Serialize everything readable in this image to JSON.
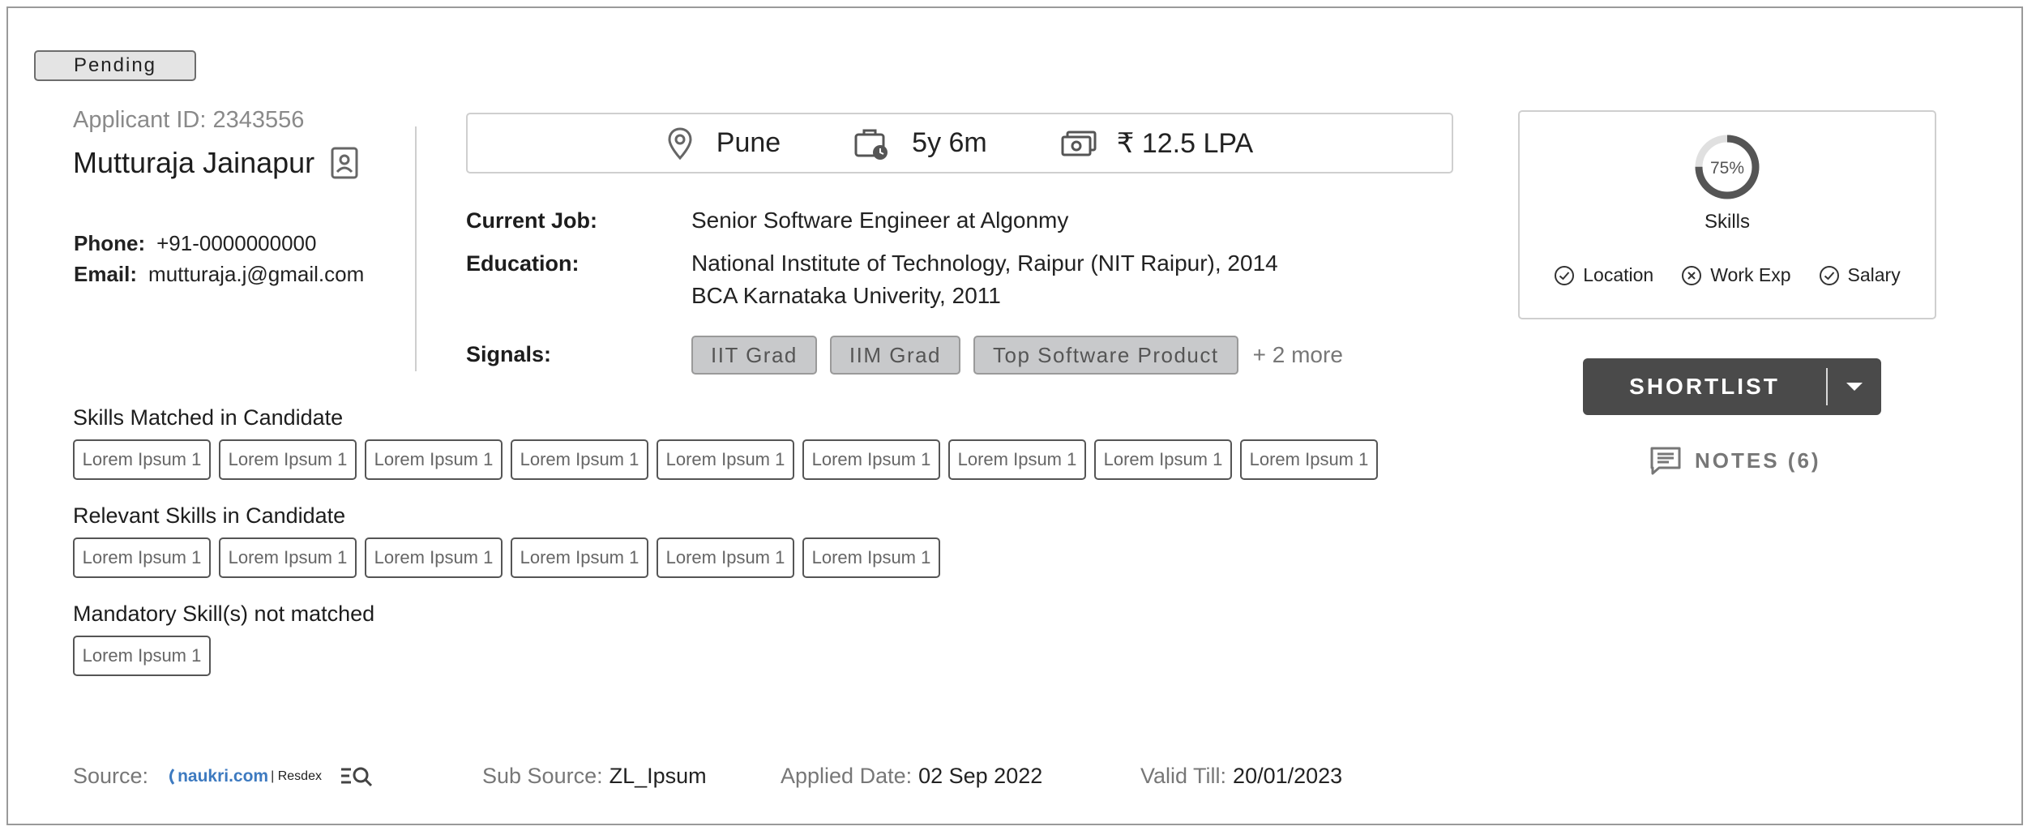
{
  "status": "Pending",
  "applicant": {
    "id_label": "Applicant ID: 2343556",
    "name": "Mutturaja Jainapur",
    "phone_label": "Phone:",
    "phone": "+91-0000000000",
    "email_label": "Email:",
    "email": "mutturaja.j@gmail.com"
  },
  "info_bar": {
    "location": "Pune",
    "experience": "5y 6m",
    "salary": "₹ 12.5 LPA"
  },
  "details": {
    "current_job_label": "Current Job:",
    "current_job": "Senior Software Engineer at Algonmy",
    "education_label": "Education:",
    "education": [
      "National Institute of Technology, Raipur (NIT Raipur), 2014",
      "BCA Karnataka Univerity, 2011"
    ],
    "signals_label": "Signals:",
    "signals": [
      "IIT Grad",
      "IIM Grad",
      "Top Software Product"
    ],
    "signals_more": "+ 2 more"
  },
  "skills_matched": {
    "title": "Skills Matched in Candidate",
    "items": [
      "Lorem Ipsum 1",
      "Lorem Ipsum 1",
      "Lorem Ipsum 1",
      "Lorem Ipsum 1",
      "Lorem Ipsum 1",
      "Lorem Ipsum 1",
      "Lorem Ipsum 1",
      "Lorem Ipsum 1",
      "Lorem Ipsum 1"
    ]
  },
  "relevant_skills": {
    "title": "Relevant Skills in Candidate",
    "items": [
      "Lorem Ipsum 1",
      "Lorem Ipsum 1",
      "Lorem Ipsum 1",
      "Lorem Ipsum 1",
      "Lorem Ipsum 1",
      "Lorem Ipsum 1"
    ]
  },
  "mandatory_unmatched": {
    "title": "Mandatory Skill(s) not matched",
    "items": [
      "Lorem Ipsum 1"
    ]
  },
  "match": {
    "percent": 75,
    "percent_label": "75%",
    "label": "Skills",
    "criteria": [
      {
        "label": "Location",
        "state": "matched",
        "icon": "check-circle-icon"
      },
      {
        "label": "Work Exp",
        "state": "unmatched",
        "icon": "x-circle-icon"
      },
      {
        "label": "Salary",
        "state": "matched",
        "icon": "check-circle-icon"
      }
    ]
  },
  "actions": {
    "shortlist_label": "SHORTLIST",
    "notes_label": "NOTES (6)"
  },
  "footer": {
    "source_label": "Source:",
    "source_brand": "naukri.com",
    "source_brand_suffix": "| Resdex",
    "sub_source_label": "Sub Source:",
    "sub_source": "ZL_Ipsum",
    "applied_label": "Applied Date:",
    "applied_date": "02 Sep 2022",
    "valid_label": "Valid Till:",
    "valid_till": "20/01/2023"
  },
  "colors": {
    "dark_button": "#4a4a4a",
    "chip_gray": "#c8c9cb",
    "brand_blue": "#3d7ac0",
    "ring_active": "#555555",
    "ring_track": "#e0e0e0"
  }
}
